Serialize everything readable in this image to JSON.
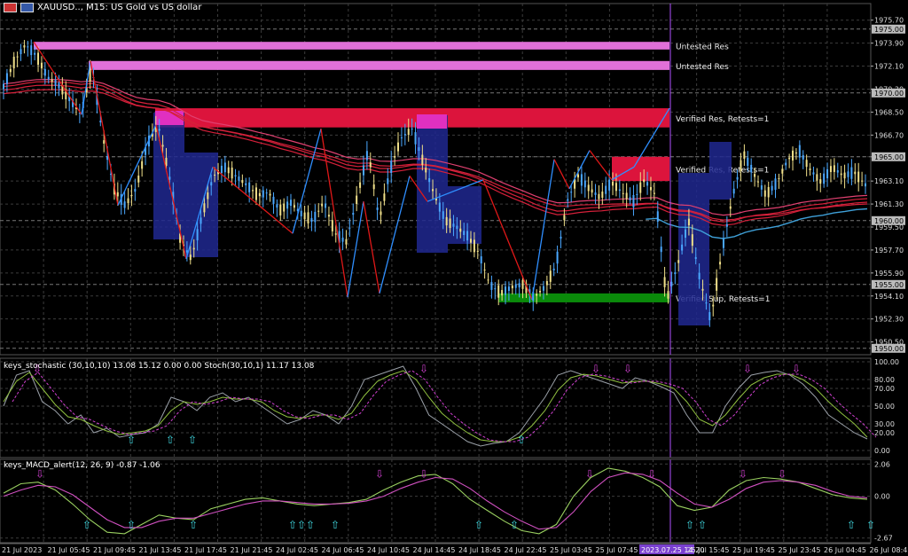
{
  "window": {
    "title": "XAUUSD.., M15:  US Gold vs US dollar",
    "stoch_title": "keys_stochastic (30,10,10) 13.08 15.12 0.00 0.00 Stoch(30,10,1) 11.17 13.08",
    "macd_title": "keys_MACD_alert(12, 26, 9) -0.87 -1.06"
  },
  "colors": {
    "background": "#000000",
    "grid": "#3c3c3c",
    "up_candle": "#4aa8ff",
    "down_candle": "#f0e08a",
    "ema": "#d6203a",
    "ema_blue": "#3fa0d8",
    "zigzag_red": "#e01818",
    "zigzag_blue": "#2f8fff",
    "untested_res": "#e070d8",
    "verified_res": "#dc143c",
    "verified_sup": "#0a8a0a",
    "box_blue": "#202890",
    "arrow_up": "#40d8e0",
    "arrow_down": "#d040d0",
    "stoch_main": "#9aa0a8",
    "stoch_signal": "#90c040",
    "stoch_dash": "#d040d0",
    "macd_line": "#9ad060",
    "macd_signal": "#d050c0"
  },
  "chart_data": [
    {
      "type": "candlestick",
      "title": "XAUUSD.., M15:  US Gold vs US dollar",
      "ylim": [
        1949.5,
        1977.0
      ],
      "y_ticks": [
        1975.7,
        1973.9,
        1972.1,
        1970.3,
        1968.5,
        1966.7,
        1965.0,
        1963.1,
        1961.3,
        1959.5,
        1957.7,
        1955.9,
        1954.1,
        1952.3,
        1950.5
      ],
      "y_labels": [
        "1975.70",
        "1973.90",
        "1972.10",
        "1970.30",
        "1968.50",
        "1966.70",
        "1965.00",
        "1963.10",
        "1961.30",
        "1959.50",
        "1957.70",
        "1955.90",
        "1954.10",
        "1952.30",
        "1950.50"
      ],
      "price_badges": [
        "1975.00",
        "1970.00",
        "1965.00",
        "1960.00",
        "1955.00",
        "1950.00"
      ],
      "x_labels": [
        "21 Jul 2023",
        "21 Jul 05:45",
        "21 Jul 09:45",
        "21 Jul 13:45",
        "21 Jul 17:45",
        "21 Jul 21:45",
        "24 Jul 02:45",
        "24 Jul 06:45",
        "24 Jul 10:45",
        "24 Jul 14:45",
        "24 Jul 18:45",
        "24 Jul 22:45",
        "25 Jul 03:45",
        "25 Jul 07:45",
        "2023.07.25 14:20",
        "25 Jul 15:45",
        "25 Jul 19:45",
        "25 Jul 23:45",
        "26 Jul 04:45",
        "26 Jul 08:45"
      ],
      "close_path": [
        1970.5,
        1972.5,
        1973.8,
        1972.9,
        1971.2,
        1970.6,
        1969.5,
        1968.3,
        1972.0,
        1966.5,
        1962.5,
        1961.2,
        1962.5,
        1966.0,
        1967.5,
        1963.5,
        1958.5,
        1957.0,
        1960.5,
        1963.5,
        1964.2,
        1963.5,
        1962.8,
        1962.0,
        1962.2,
        1960.8,
        1961.4,
        1960.5,
        1960.0,
        1961.5,
        1959.0,
        1958.3,
        1961.8,
        1965.5,
        1960.0,
        1964.0,
        1966.5,
        1967.2,
        1964.5,
        1962.0,
        1960.0,
        1959.5,
        1958.8,
        1957.5,
        1955.0,
        1954.3,
        1954.8,
        1955.0,
        1954.0,
        1954.8,
        1956.5,
        1961.5,
        1963.5,
        1962.5,
        1961.8,
        1963.0,
        1962.2,
        1961.5,
        1963.2,
        1962.0,
        1953.8,
        1956.5,
        1960.0,
        1955.5,
        1952.2,
        1957.5,
        1962.0,
        1965.2,
        1963.5,
        1962.0,
        1963.0,
        1964.8,
        1965.5,
        1964.0,
        1963.0,
        1964.2,
        1963.5,
        1963.8,
        1962.8
      ],
      "zones": [
        {
          "label": "Untested Res",
          "top": 1974.0,
          "bottom": 1973.4
        },
        {
          "label": "Untested Res",
          "top": 1972.5,
          "bottom": 1971.8
        },
        {
          "label": "Verified Res, Retests=1",
          "top": 1968.8,
          "bottom": 1967.3
        },
        {
          "label": "Verified Res, Retests=1",
          "top": 1965.0,
          "bottom": 1963.1
        },
        {
          "label": "Verified Sup, Retests=1",
          "top": 1954.3,
          "bottom": 1953.6
        }
      ],
      "zigzag": [
        1974.0,
        1968.3,
        1972.5,
        1961.2,
        1967.5,
        1957.0,
        1964.2,
        1959.0,
        1967.2,
        1954.0,
        1961.5,
        1954.3,
        1963.5,
        1961.5,
        1963.2,
        1953.8,
        1964.8,
        1962.5,
        1965.5,
        1963.2,
        1964.2,
        1968.8
      ]
    },
    {
      "type": "line",
      "title": "keys_stochastic (30,10,10) 13.08 15.12 0.00 0.00 Stoch(30,10,1) 11.17 13.08",
      "ylim": [
        0,
        100
      ],
      "y_labels": [
        "100.00",
        "80.00",
        "70.00",
        "50.00",
        "30.00",
        "20.00",
        "0.00"
      ],
      "y_ticks": [
        100,
        80,
        70,
        50,
        30,
        20,
        0
      ],
      "series": [
        {
          "name": "Stoch(30,10,1)",
          "values": [
            50,
            85,
            90,
            55,
            45,
            30,
            40,
            20,
            25,
            15,
            18,
            20,
            30,
            60,
            55,
            45,
            60,
            65,
            55,
            60,
            50,
            40,
            30,
            35,
            45,
            40,
            30,
            50,
            80,
            85,
            90,
            95,
            70,
            40,
            30,
            20,
            10,
            5,
            8,
            10,
            20,
            40,
            60,
            85,
            90,
            85,
            80,
            75,
            70,
            82,
            78,
            72,
            65,
            40,
            20,
            20,
            50,
            70,
            85,
            88,
            90,
            85,
            75,
            60,
            40,
            30,
            20,
            13
          ]
        },
        {
          "name": "keys_stochastic",
          "values": [
            55,
            78,
            88,
            70,
            52,
            38,
            35,
            28,
            22,
            18,
            20,
            22,
            28,
            45,
            55,
            52,
            55,
            60,
            58,
            58,
            55,
            45,
            38,
            36,
            40,
            40,
            35,
            42,
            62,
            78,
            85,
            90,
            80,
            60,
            42,
            30,
            20,
            12,
            10,
            10,
            15,
            28,
            45,
            68,
            82,
            86,
            84,
            80,
            76,
            78,
            78,
            75,
            70,
            55,
            35,
            28,
            40,
            58,
            74,
            82,
            86,
            86,
            80,
            70,
            55,
            42,
            30,
            15
          ]
        }
      ],
      "arrows_up": 4,
      "arrows_down": 7
    },
    {
      "type": "line",
      "title": "keys_MACD_alert(12, 26, 9) -0.87 -1.06",
      "ylim": [
        -2.67,
        2.06
      ],
      "y_labels": [
        "2.06",
        "0.00",
        "-2.67"
      ],
      "y_ticks": [
        2.06,
        0.0,
        -2.67
      ],
      "series": [
        {
          "name": "MACD",
          "values": [
            0.2,
            0.8,
            0.9,
            0.4,
            -0.5,
            -1.5,
            -2.3,
            -2.4,
            -1.8,
            -1.2,
            -1.4,
            -1.5,
            -0.8,
            -0.5,
            -0.2,
            -0.1,
            -0.3,
            -0.5,
            -0.6,
            -0.5,
            -0.4,
            -0.2,
            0.4,
            0.9,
            1.3,
            1.4,
            0.8,
            -0.2,
            -0.9,
            -1.6,
            -2.2,
            -2.4,
            -1.8,
            0.0,
            1.2,
            1.8,
            1.6,
            1.2,
            0.6,
            -0.6,
            -0.9,
            -0.7,
            0.4,
            1.0,
            1.2,
            1.1,
            0.9,
            0.5,
            0.1,
            -0.1,
            -0.2
          ]
        },
        {
          "name": "Signal",
          "values": [
            0.0,
            0.4,
            0.7,
            0.6,
            0.1,
            -0.7,
            -1.5,
            -2.0,
            -2.0,
            -1.6,
            -1.4,
            -1.4,
            -1.1,
            -0.8,
            -0.5,
            -0.3,
            -0.3,
            -0.4,
            -0.5,
            -0.5,
            -0.45,
            -0.3,
            0.0,
            0.5,
            0.9,
            1.2,
            1.1,
            0.5,
            -0.3,
            -1.0,
            -1.6,
            -2.1,
            -2.0,
            -1.0,
            0.3,
            1.2,
            1.5,
            1.4,
            1.0,
            0.2,
            -0.5,
            -0.7,
            -0.2,
            0.5,
            0.9,
            1.0,
            0.9,
            0.7,
            0.3,
            0.0,
            -0.1
          ]
        }
      ],
      "arrows_up": 9,
      "arrows_down": 8
    }
  ]
}
